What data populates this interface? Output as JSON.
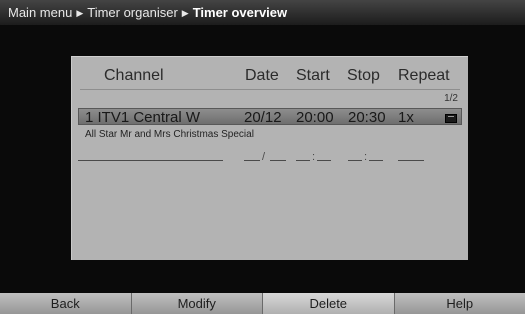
{
  "breadcrumb": {
    "items": [
      "Main menu",
      "Timer organiser"
    ],
    "current": "Timer overview",
    "separator_icon": "triangle-right-icon"
  },
  "table": {
    "headers": {
      "channel": "Channel",
      "date": "Date",
      "start": "Start",
      "stop": "Stop",
      "repeat": "Repeat"
    },
    "page": "1/2",
    "rows": [
      {
        "channel": "1 ITV1 Central W",
        "date": "20/12",
        "start": "20:00",
        "stop": "20:30",
        "repeat": "1x",
        "programme": "All Star Mr and Mrs Christmas Special",
        "icon": "subtitles-icon",
        "selected": true
      }
    ],
    "empty_row": {
      "date_sep": "/",
      "start_sep": ":",
      "stop_sep": ":"
    }
  },
  "buttons": [
    {
      "label": "Back"
    },
    {
      "label": "Modify"
    },
    {
      "label": "Delete",
      "active": true
    },
    {
      "label": "Help"
    }
  ],
  "colors": {
    "panel": "#b3b3b3",
    "selection": "#7a7a7a",
    "background": "#0a0a0a"
  }
}
